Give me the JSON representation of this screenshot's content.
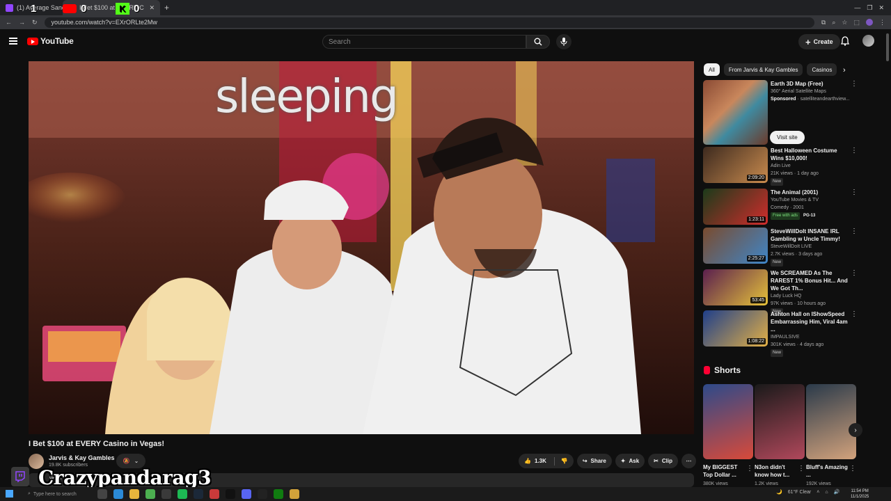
{
  "browser": {
    "tabs": [
      {
        "label": "(1) Average Sanctuary - Twit",
        "active": false,
        "color": "#9146ff"
      },
      {
        "label": "I Bet $100 at EVERY C",
        "active": true,
        "color": "#ff0000"
      }
    ],
    "counter": {
      "left": "1",
      "mid": "0",
      "right": "0"
    },
    "url": "youtube.com/watch?v=EXrORLte2Mw"
  },
  "youtube": {
    "logo": "YouTube",
    "search_placeholder": "Search",
    "create_label": "Create",
    "icons": {
      "menu": "menu-icon",
      "search": "search-icon",
      "mic": "mic-icon",
      "bell": "bell-icon"
    }
  },
  "video": {
    "overlay_text": "sleeping",
    "title": "I Bet $100 at EVERY Casino in Vegas!",
    "channel": "Jarvis & Kay Gambles",
    "subscribers": "19.8K subscribers",
    "like_count": "1.3K",
    "share_label": "Share",
    "ask_label": "Ask",
    "clip_label": "Clip",
    "desc_partial": "views"
  },
  "stream_overlay": {
    "name": "Crazypandarag3"
  },
  "sidebar": {
    "chips": [
      "All",
      "From Jarvis & Kay Gambles",
      "Casinos"
    ],
    "sponsored": {
      "title": "Earth 3D Map (Free)",
      "subtitle": "360° Aerial Satellite Maps",
      "sponsor": "Sponsored",
      "domain": "satelliteandearthview...",
      "button": "Visit site"
    },
    "recommendations": [
      {
        "title": "Best Halloween Costume Wins $10,000!",
        "channel": "Adin Live",
        "meta": "21K views · 1 day ago",
        "badge": "New",
        "duration": "2:09:20",
        "c1": "#3d2a1f",
        "c2": "#c98b4e"
      },
      {
        "title": "The Animal (2001)",
        "channel": "YouTube Movies & TV",
        "meta": "Comedy · 2001",
        "badge": "Free with ads",
        "rating": "PG-13",
        "duration": "1:23:11",
        "c1": "#1b3b1a",
        "c2": "#d12c2c"
      },
      {
        "title": "SteveWillDoIt INSANE IRL Gambling w Uncle Timmy!",
        "channel": "SteveWillDoIt LIVE",
        "meta": "2.7K views · 3 days ago",
        "badge": "New",
        "duration": "2:25:27",
        "c1": "#7a4b2e",
        "c2": "#3f86c8"
      },
      {
        "title": "We SCREAMED As The RAREST 1% Bonus Hit... And We Got Th...",
        "channel": "Lady Luck HQ",
        "meta": "97K views · 10 hours ago",
        "badge": "New",
        "duration": "53:45",
        "c1": "#5a1f4e",
        "c2": "#e6c23a"
      },
      {
        "title": "Ashton Hall on IShowSpeed Embarrassing Him, Viral 4am ...",
        "channel": "IMPAULSIVE",
        "meta": "301K views · 4 days ago",
        "badge": "New",
        "duration": "1:08:22",
        "c1": "#1f3f8a",
        "c2": "#e3b046"
      }
    ],
    "shorts_label": "Shorts",
    "shorts": [
      {
        "title": "My BIGGEST Top Dollar ...",
        "views": "380K views",
        "c1": "#2d4a8a",
        "c2": "#d84a3a"
      },
      {
        "title": "N3on didn't know how t...",
        "views": "1.2K views",
        "c1": "#1a1a1a",
        "c2": "#b0485b"
      },
      {
        "title": "Bluff's Amazing ...",
        "views": "192K views",
        "c1": "#2a3a4a",
        "c2": "#d2a27c"
      }
    ]
  },
  "taskbar": {
    "search_placeholder": "Type here to search",
    "weather": "61°F Clear",
    "time": "11:54 PM",
    "date": "11/1/2025"
  }
}
